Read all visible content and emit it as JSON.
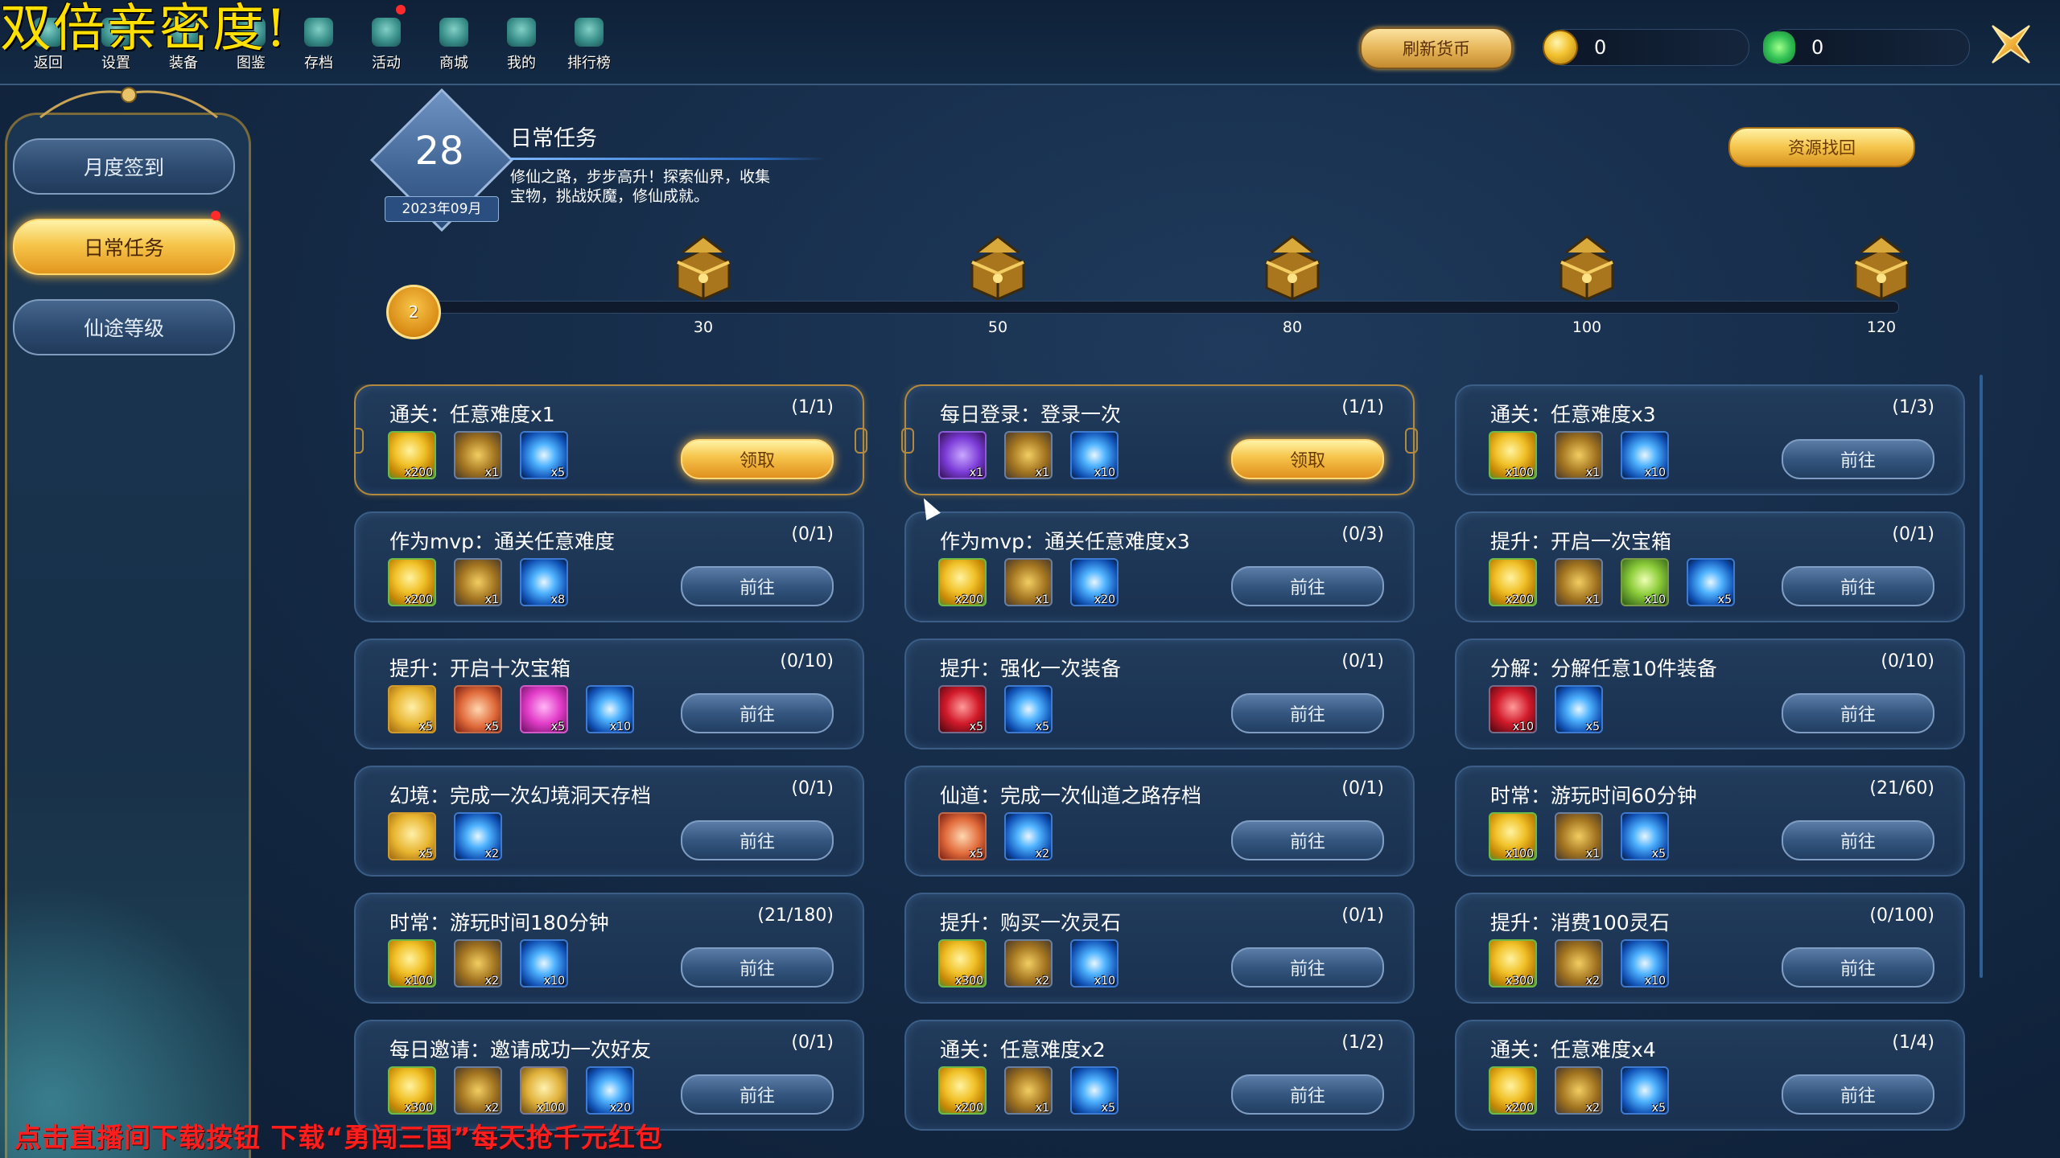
{
  "overlay": {
    "title": "双倍亲密度",
    "title_suffix": "!",
    "bottom_banner": "点击直播间下载按钮 下载“勇闯三国”每天抢千元红包"
  },
  "topnav": [
    {
      "label": "返回",
      "icon": "back-icon"
    },
    {
      "label": "设置",
      "icon": "settings-icon"
    },
    {
      "label": "装备",
      "icon": "equipment-icon"
    },
    {
      "label": "图鉴",
      "icon": "codex-icon"
    },
    {
      "label": "存档",
      "icon": "save-icon"
    },
    {
      "label": "活动",
      "icon": "event-icon"
    },
    {
      "label": "商城",
      "icon": "shop-icon"
    },
    {
      "label": "我的",
      "icon": "profile-icon"
    },
    {
      "label": "排行榜",
      "icon": "ranking-icon"
    }
  ],
  "header": {
    "refresh_label": "刷新货币",
    "coin_amount": "0",
    "clover_amount": "0"
  },
  "sidebar": {
    "items": [
      {
        "label": "月度签到"
      },
      {
        "label": "日常任务"
      },
      {
        "label": "仙途等级"
      }
    ]
  },
  "panel": {
    "day": "28",
    "month": "2023年09月",
    "title": "日常任务",
    "description": "修仙之路，步步高升！探索仙界，收集宝物，挑战妖魔，修仙成就。",
    "recycle_label": "资源找回"
  },
  "progress": {
    "current": "2",
    "current_value": 2,
    "max_value": 120,
    "milestones": [
      "30",
      "50",
      "80",
      "100",
      "120"
    ]
  },
  "buttons": {
    "goto": "前往",
    "claim": "领取"
  },
  "tasks": [
    {
      "title": "通关：任意难度x1",
      "progress": "(1/1)",
      "claimable": true,
      "rewards": [
        {
          "icon": "coin",
          "qty": "x200"
        },
        {
          "icon": "chest",
          "qty": "x1"
        },
        {
          "icon": "orb",
          "qty": "x5"
        }
      ]
    },
    {
      "title": "每日登录：登录一次",
      "progress": "(1/1)",
      "claimable": true,
      "rewards": [
        {
          "icon": "sword",
          "qty": "x1"
        },
        {
          "icon": "chest",
          "qty": "x1"
        },
        {
          "icon": "orb",
          "qty": "x10"
        }
      ]
    },
    {
      "title": "通关：任意难度x3",
      "progress": "(1/3)",
      "claimable": false,
      "rewards": [
        {
          "icon": "coin",
          "qty": "x100"
        },
        {
          "icon": "chest",
          "qty": "x1"
        },
        {
          "icon": "orb",
          "qty": "x10"
        }
      ]
    },
    {
      "title": "作为mvp：通关任意难度",
      "progress": "(0/1)",
      "claimable": false,
      "rewards": [
        {
          "icon": "coin",
          "qty": "x200"
        },
        {
          "icon": "chest",
          "qty": "x1"
        },
        {
          "icon": "orb",
          "qty": "x8"
        }
      ]
    },
    {
      "title": "作为mvp：通关任意难度x3",
      "progress": "(0/3)",
      "claimable": false,
      "rewards": [
        {
          "icon": "coin",
          "qty": "x200"
        },
        {
          "icon": "chest",
          "qty": "x1"
        },
        {
          "icon": "orb",
          "qty": "x20"
        }
      ]
    },
    {
      "title": "提升：开启一次宝箱",
      "progress": "(0/1)",
      "claimable": false,
      "rewards": [
        {
          "icon": "coin",
          "qty": "x200"
        },
        {
          "icon": "chest",
          "qty": "x1"
        },
        {
          "icon": "spirit",
          "qty": "x10"
        },
        {
          "icon": "orb",
          "qty": "x5"
        }
      ]
    },
    {
      "title": "提升：开启十次宝箱",
      "progress": "(0/10)",
      "claimable": false,
      "rewards": [
        {
          "icon": "shield",
          "qty": "x5"
        },
        {
          "icon": "book",
          "qty": "x5"
        },
        {
          "icon": "gem",
          "qty": "x5"
        },
        {
          "icon": "orb",
          "qty": "x10"
        }
      ]
    },
    {
      "title": "提升：强化一次装备",
      "progress": "(0/1)",
      "claimable": false,
      "rewards": [
        {
          "icon": "ruby",
          "qty": "x5"
        },
        {
          "icon": "orb",
          "qty": "x5"
        }
      ]
    },
    {
      "title": "分解：分解任意10件装备",
      "progress": "(0/10)",
      "claimable": false,
      "rewards": [
        {
          "icon": "ruby",
          "qty": "x10"
        },
        {
          "icon": "orb",
          "qty": "x5"
        }
      ]
    },
    {
      "title": "幻境：完成一次幻境洞天存档",
      "progress": "(0/1)",
      "claimable": false,
      "rewards": [
        {
          "icon": "shield",
          "qty": "x5"
        },
        {
          "icon": "orb",
          "qty": "x2"
        }
      ]
    },
    {
      "title": "仙道：完成一次仙道之路存档",
      "progress": "(0/1)",
      "claimable": false,
      "rewards": [
        {
          "icon": "book",
          "qty": "x5"
        },
        {
          "icon": "orb",
          "qty": "x2"
        }
      ]
    },
    {
      "title": "时常：游玩时间60分钟",
      "progress": "(21/60)",
      "claimable": false,
      "rewards": [
        {
          "icon": "coin",
          "qty": "x100"
        },
        {
          "icon": "chest",
          "qty": "x1"
        },
        {
          "icon": "orb",
          "qty": "x5"
        }
      ]
    },
    {
      "title": "时常：游玩时间180分钟",
      "progress": "(21/180)",
      "claimable": false,
      "rewards": [
        {
          "icon": "coin",
          "qty": "x100"
        },
        {
          "icon": "chest",
          "qty": "x2"
        },
        {
          "icon": "orb",
          "qty": "x10"
        }
      ]
    },
    {
      "title": "提升：购买一次灵石",
      "progress": "(0/1)",
      "claimable": false,
      "rewards": [
        {
          "icon": "coin",
          "qty": "x300"
        },
        {
          "icon": "chest",
          "qty": "x2"
        },
        {
          "icon": "orb",
          "qty": "x10"
        }
      ]
    },
    {
      "title": "提升：消费100灵石",
      "progress": "(0/100)",
      "claimable": false,
      "rewards": [
        {
          "icon": "coin",
          "qty": "x300"
        },
        {
          "icon": "chest",
          "qty": "x2"
        },
        {
          "icon": "orb",
          "qty": "x10"
        }
      ]
    },
    {
      "title": "每日邀请：邀请成功一次好友",
      "progress": "(0/1)",
      "claimable": false,
      "rewards": [
        {
          "icon": "coin",
          "qty": "x300"
        },
        {
          "icon": "chest",
          "qty": "x2"
        },
        {
          "icon": "scroll",
          "qty": "x100"
        },
        {
          "icon": "orb",
          "qty": "x20"
        }
      ]
    },
    {
      "title": "通关：任意难度x2",
      "progress": "(1/2)",
      "claimable": false,
      "rewards": [
        {
          "icon": "coin",
          "qty": "x200"
        },
        {
          "icon": "chest",
          "qty": "x1"
        },
        {
          "icon": "orb",
          "qty": "x5"
        }
      ]
    },
    {
      "title": "通关：任意难度x4",
      "progress": "(1/4)",
      "claimable": false,
      "rewards": [
        {
          "icon": "coin",
          "qty": "x200"
        },
        {
          "icon": "chest",
          "qty": "x2"
        },
        {
          "icon": "orb",
          "qty": "x5"
        }
      ]
    }
  ]
}
